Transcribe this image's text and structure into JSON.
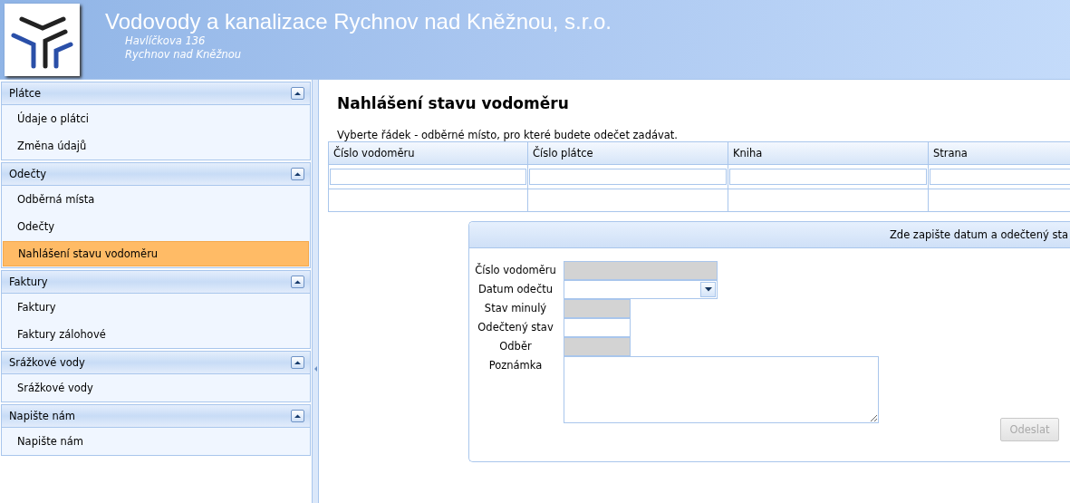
{
  "header": {
    "company": "Vodovody a kanalizace Rychnov nad Kněžnou, s.r.o.",
    "address_lines": [
      "Havlíčkova 136",
      "Rychnov nad Kněžnou"
    ]
  },
  "sidebar": {
    "groups": [
      {
        "title": "Plátce",
        "expanded": true,
        "items": [
          {
            "label": "Údaje o plátci",
            "selected": false
          },
          {
            "label": "Změna údajů",
            "selected": false
          }
        ]
      },
      {
        "title": "Odečty",
        "expanded": true,
        "items": [
          {
            "label": "Odběrná místa",
            "selected": false
          },
          {
            "label": "Odečty",
            "selected": false
          },
          {
            "label": "Nahlášení stavu vodoměru",
            "selected": true
          }
        ]
      },
      {
        "title": "Faktury",
        "expanded": true,
        "items": [
          {
            "label": "Faktury",
            "selected": false
          },
          {
            "label": "Faktury zálohové",
            "selected": false
          }
        ]
      },
      {
        "title": "Srážkové vody",
        "expanded": true,
        "items": [
          {
            "label": "Srážkové vody",
            "selected": false
          }
        ]
      },
      {
        "title": "Napište nám",
        "expanded": true,
        "items": [
          {
            "label": "Napište nám",
            "selected": false
          }
        ]
      }
    ]
  },
  "page": {
    "title": "Nahlášení stavu vodoměru",
    "instruction": "Vyberte řádek - odběrné místo, pro které budete odečet zadávat.",
    "table": {
      "columns": [
        "Číslo vodoměru",
        "Číslo plátce",
        "Kniha",
        "Strana"
      ]
    },
    "form": {
      "title": "Zde zapište datum a odečtený sta",
      "fields": [
        {
          "label": "Číslo vodoměru",
          "kind": "text",
          "disabled": true
        },
        {
          "label": "Datum odečtu",
          "kind": "date",
          "disabled": false
        },
        {
          "label": "Stav minulý",
          "kind": "number",
          "disabled": true
        },
        {
          "label": "Odečtený stav",
          "kind": "number",
          "disabled": false
        },
        {
          "label": "Odběr",
          "kind": "number",
          "disabled": true
        },
        {
          "label": "Poznámka",
          "kind": "textarea",
          "disabled": false
        }
      ],
      "submit": {
        "label": "Odeslat",
        "disabled": true
      }
    }
  }
}
